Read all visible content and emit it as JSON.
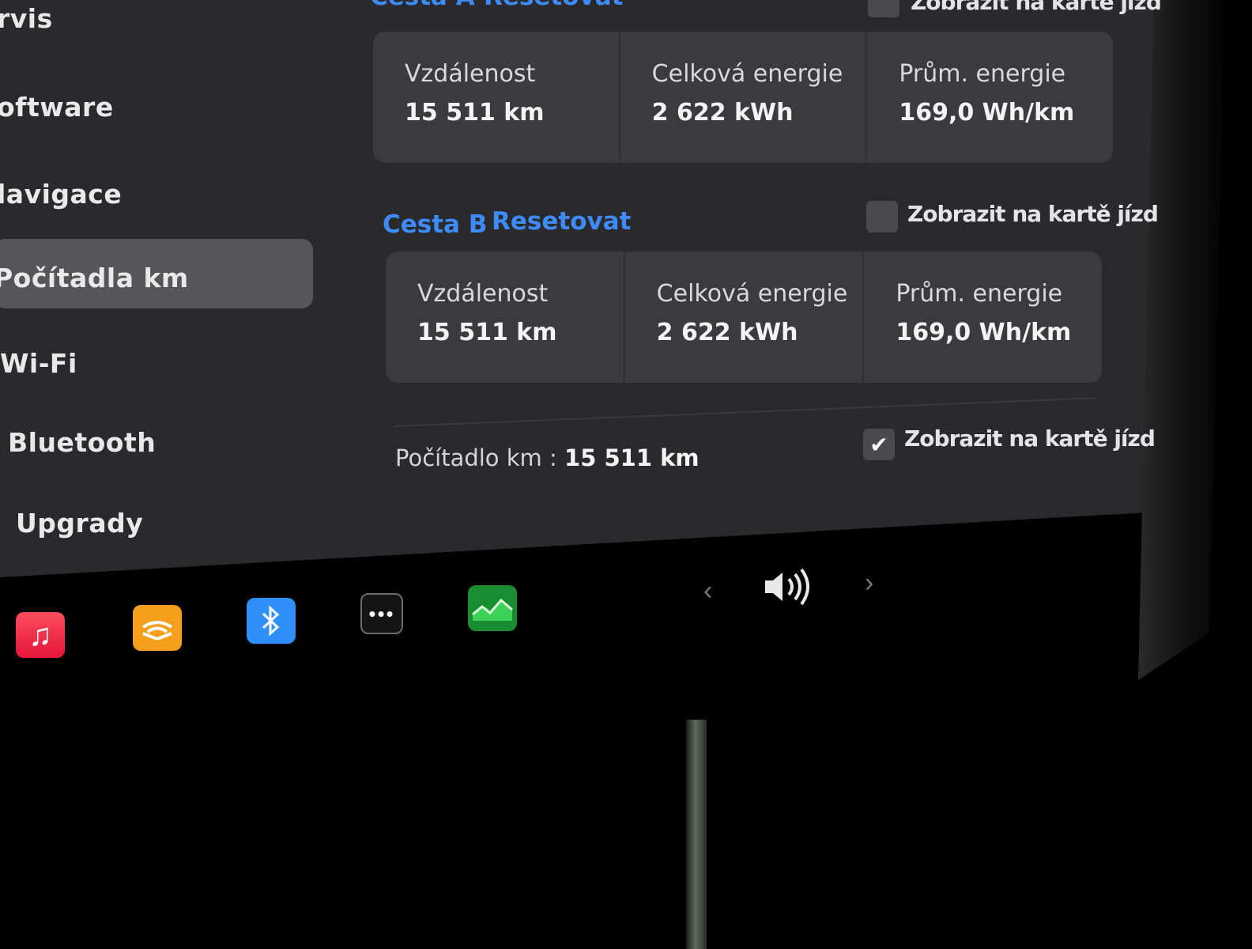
{
  "sidebar": {
    "items": [
      {
        "label": "rvis"
      },
      {
        "label": "oftware"
      },
      {
        "label": "lavigace"
      },
      {
        "label": "Počítadla km",
        "active": true
      },
      {
        "label": "Wi-Fi"
      },
      {
        "label": "Bluetooth"
      },
      {
        "label": "Upgrady"
      }
    ]
  },
  "trip_a": {
    "title": "Cesta A",
    "reset": "Resetovat",
    "show_label": "Zobrazit na kartě jízd",
    "checked": false,
    "stats": [
      {
        "label": "Vzdálenost",
        "value": "15 511 km"
      },
      {
        "label": "Celková energie",
        "value": "2 622 kWh"
      },
      {
        "label": "Prům. energie",
        "value": "169,0 Wh/km"
      }
    ]
  },
  "trip_b": {
    "title": "Cesta B",
    "reset": "Resetovat",
    "show_label": "Zobrazit na kartě jízd",
    "checked": false,
    "stats": [
      {
        "label": "Vzdálenost",
        "value": "15 511 km"
      },
      {
        "label": "Celková energie",
        "value": "2 622 kWh"
      },
      {
        "label": "Prům. energie",
        "value": "169,0 Wh/km"
      }
    ]
  },
  "odometer": {
    "label": "Počítadlo km :",
    "value": "15 511 km",
    "show_label": "Zobrazit na kartě jízd",
    "checked": true
  },
  "dock": {
    "icons": [
      "music-icon",
      "audible-icon",
      "bluetooth-icon",
      "more-icon",
      "energy-app-icon"
    ],
    "prev": "‹",
    "next": "›",
    "volume_icon": "speaker-volume-icon"
  },
  "colors": {
    "accent": "#3d8bff",
    "panel": "#2a2a2c",
    "card": "#3b3b3e",
    "active_item": "#56565a"
  }
}
